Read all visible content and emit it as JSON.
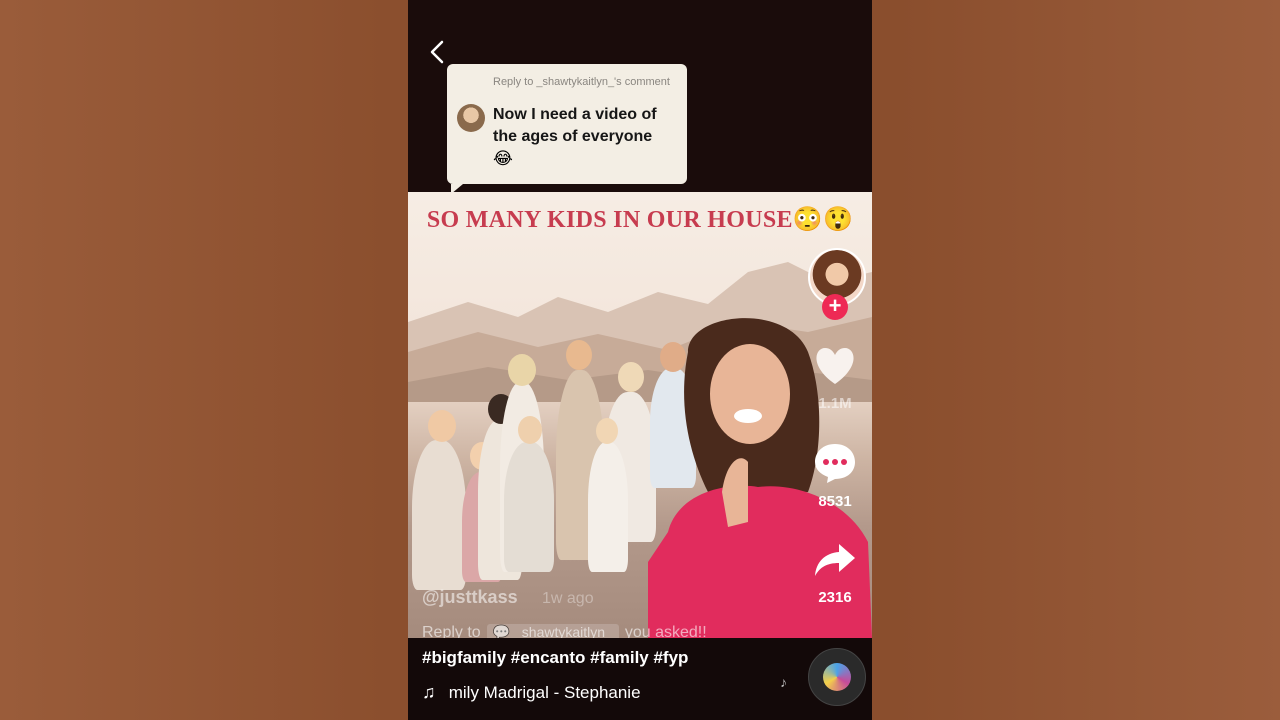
{
  "comment_reply": {
    "reply_to_label": "Reply to _shawtykaitlyn_'s comment",
    "text": "Now I need a video of the ages of everyone",
    "emoji": "😂"
  },
  "video": {
    "overlay_title": "SO MANY KIDS IN OUR HOUSE😳😲"
  },
  "post": {
    "creator": "@justtkass",
    "time_ago": "1w ago",
    "reply_prefix": "Reply to",
    "reply_tag": "💬 _shawtykaitlyn_",
    "reply_suffix": "you asked!!",
    "hashtags": "#bigfamily #encanto #family #fyp",
    "music": "mily Madrigal - Stephanie"
  },
  "actions": {
    "likes": "1.1M",
    "comments": "8531",
    "shares": "2316"
  },
  "icons": {
    "back": "chevron-left-icon",
    "like": "heart-icon",
    "comment": "comment-bubble-icon",
    "share": "share-arrow-icon",
    "follow": "plus-icon",
    "music": "music-note-icon"
  },
  "colors": {
    "title_red": "#c73c4f",
    "follow_pink": "#ee2a55"
  }
}
